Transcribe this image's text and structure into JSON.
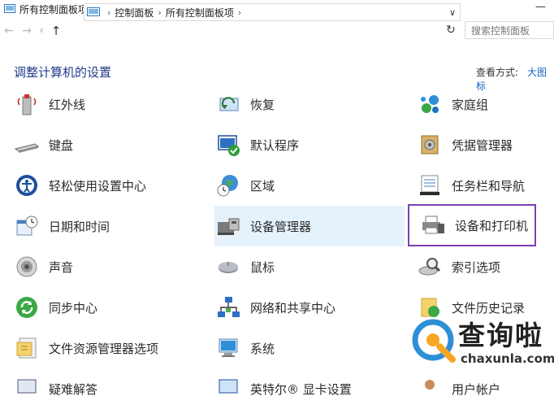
{
  "window": {
    "title": "所有控制面板项",
    "close_glyph": "—"
  },
  "address": {
    "breadcrumbs": [
      "控制面板",
      "所有控制面板项"
    ],
    "search_placeholder": "搜索控制面板"
  },
  "header": {
    "page_title": "调整计算机的设置",
    "view_by_label": "查看方式:",
    "view_by_value": "大图标"
  },
  "items": {
    "col1": [
      "红外线",
      "键盘",
      "轻松使用设置中心",
      "日期和时间",
      "声音",
      "同步中心",
      "文件资源管理器选项",
      "疑难解答"
    ],
    "col2": [
      "恢复",
      "默认程序",
      "区域",
      "设备管理器",
      "鼠标",
      "网络和共享中心",
      "系统",
      "英特尔® 显卡设置"
    ],
    "col3": [
      "家庭组",
      "凭据管理器",
      "任务栏和导航",
      "设备和打印机",
      "索引选项",
      "文件历史记录",
      "",
      "用户帐户"
    ]
  },
  "watermark": {
    "name": "查询啦",
    "domain": "chaxunla.com"
  },
  "colors": {
    "title_blue": "#1e3a8a",
    "link_blue": "#1565c0",
    "highlight_bg": "#e5f1fb",
    "selection_border": "#7b3fb0"
  }
}
